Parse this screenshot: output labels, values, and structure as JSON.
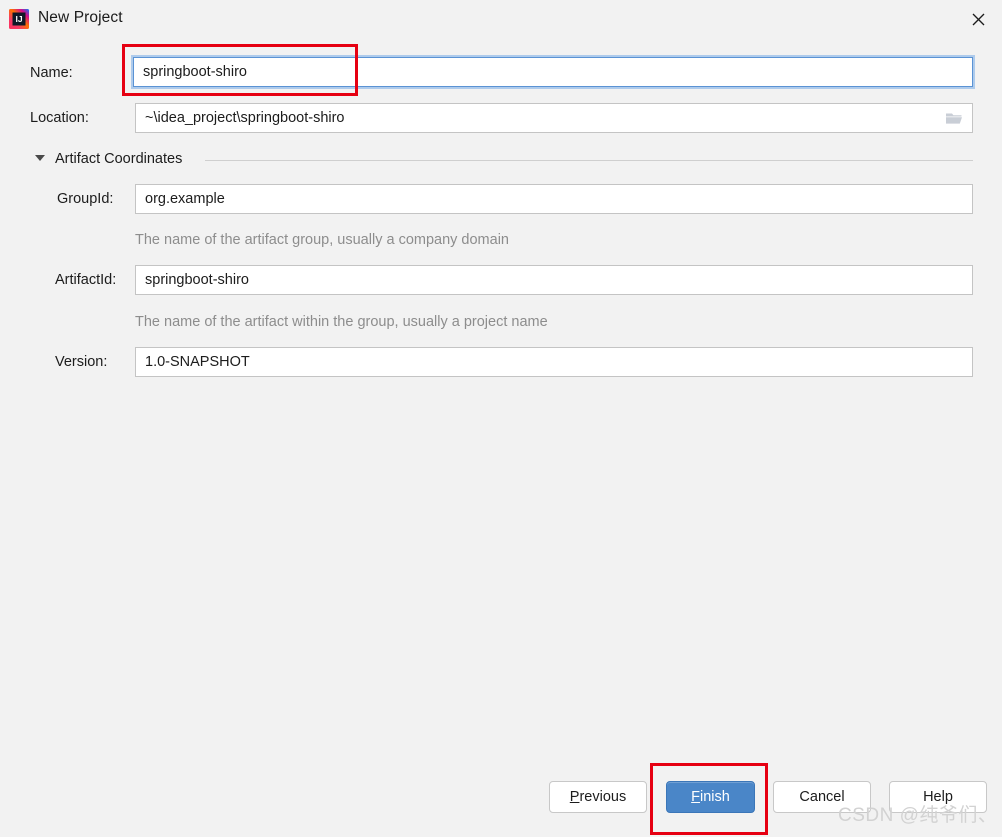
{
  "window": {
    "title": "New Project",
    "app_icon": "intellij-idea-logo-icon",
    "close_icon": "close-icon"
  },
  "form": {
    "name": {
      "label": "Name:",
      "value": "springboot-shiro",
      "placeholder": ""
    },
    "location": {
      "label": "Location:",
      "value": "~\\idea_project\\springboot-shiro",
      "placeholder": "",
      "browse_icon": "folder-open-icon"
    },
    "artifact_coordinates": {
      "section_title": "Artifact Coordinates",
      "expanded": true,
      "collapse_icon": "chevron-down-icon",
      "group_id": {
        "label": "GroupId:",
        "value": "org.example",
        "hint": "The name of the artifact group, usually a company domain"
      },
      "artifact_id": {
        "label": "ArtifactId:",
        "value": "springboot-shiro",
        "hint": "The name of the artifact within the group, usually a project name"
      },
      "version": {
        "label": "Version:",
        "value": "1.0-SNAPSHOT",
        "hint": ""
      }
    }
  },
  "buttons": {
    "previous": {
      "label": "Previous",
      "mnemonic": "P",
      "rest": "revious"
    },
    "finish": {
      "label": "Finish",
      "mnemonic": "F",
      "rest": "inish",
      "primary": true
    },
    "cancel": {
      "label": "Cancel"
    },
    "help": {
      "label": "Help"
    }
  },
  "annotations": {
    "name_highlight": "red-rectangle-around-name-field",
    "finish_highlight": "red-rectangle-around-finish-button"
  },
  "watermark": {
    "text": "CSDN @纯爷们、"
  },
  "colors": {
    "background": "#f2f2f2",
    "field_background": "#ffffff",
    "field_border": "#c4c4c4",
    "focus_border": "#5b93d4",
    "focus_glow": "#aecbec",
    "primary_button": "#4a86c8",
    "annotation_red": "#e60012",
    "hint_text": "#8d8d8d"
  }
}
